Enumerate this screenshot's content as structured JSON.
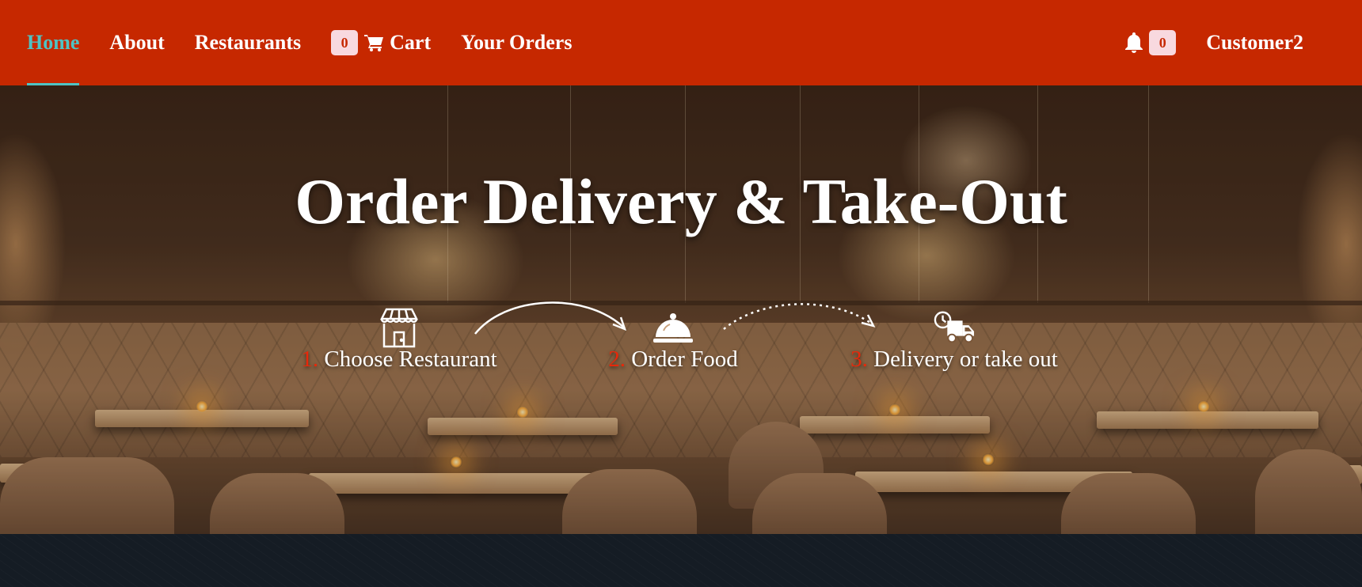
{
  "nav": {
    "home": "Home",
    "about": "About",
    "restaurants": "Restaurants",
    "cart_count": "0",
    "cart": "Cart",
    "your_orders": "Your Orders",
    "notification_count": "0",
    "user": "Customer2"
  },
  "hero": {
    "title": "Order Delivery & Take-Out",
    "steps": [
      {
        "num": "1.",
        "label": "Choose Restaurant",
        "icon": "store-icon"
      },
      {
        "num": "2.",
        "label": "Order Food",
        "icon": "food-cloche-icon"
      },
      {
        "num": "3.",
        "label": "Delivery or take out",
        "icon": "delivery-truck-icon"
      }
    ]
  },
  "colors": {
    "navbar": "#c62800",
    "active_link": "#4fc3c4",
    "badge_bg": "#f8d9df",
    "step_number": "#e8280a"
  }
}
